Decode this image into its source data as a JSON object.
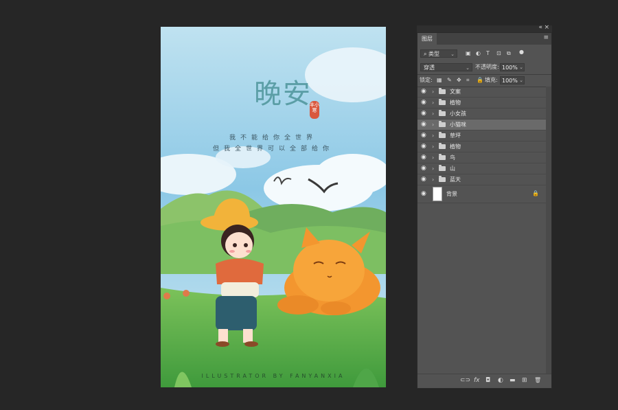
{
  "canvas": {
    "title": "晚安",
    "seal_text": "丰小\n寒",
    "line1": "我不能给你全世界",
    "line2": "但我全世界可以全部给你",
    "footer": "ILLUSTRATOR BY FANYANXIA"
  },
  "panel": {
    "tab_label": "图层",
    "top_controls": [
      "«",
      "×"
    ],
    "filter": {
      "label": "类型",
      "icons": [
        "image-filter-icon",
        "adjustment-filter-icon",
        "type-filter-icon",
        "shape-filter-icon",
        "smart-object-filter-icon",
        "toggle-filter-icon"
      ]
    },
    "blend_mode": "穿透",
    "opacity_label": "不透明度:",
    "opacity_value": "100%",
    "lock_label": "锁定:",
    "fill_label": "填充:",
    "fill_value": "100%",
    "layers": [
      {
        "name": "文案",
        "type": "group",
        "selected": false
      },
      {
        "name": "植物",
        "type": "group",
        "selected": false
      },
      {
        "name": "小女孩",
        "type": "group",
        "selected": false
      },
      {
        "name": "小猫咪",
        "type": "group",
        "selected": true
      },
      {
        "name": "草坪",
        "type": "group",
        "selected": false
      },
      {
        "name": "植物",
        "type": "group",
        "selected": false
      },
      {
        "name": "鸟",
        "type": "group",
        "selected": false
      },
      {
        "name": "山",
        "type": "group",
        "selected": false
      },
      {
        "name": "蓝天",
        "type": "group",
        "selected": false
      },
      {
        "name": "背景",
        "type": "background",
        "selected": false,
        "locked": true
      }
    ],
    "bottom_icons": [
      "link-layers-icon",
      "fx-icon",
      "add-mask-icon",
      "adjustment-layer-icon",
      "new-group-icon",
      "new-layer-icon",
      "delete-layer-icon"
    ],
    "bottom_glyphs": [
      "⊂⊃",
      "fx",
      "◘",
      "◐",
      "▬",
      "⊞",
      "🗑"
    ]
  },
  "colors": {
    "workspace": "#262626",
    "panel": "#535353",
    "selected_layer": "#6a6a6a",
    "title_teal": "#5b9ea6"
  }
}
